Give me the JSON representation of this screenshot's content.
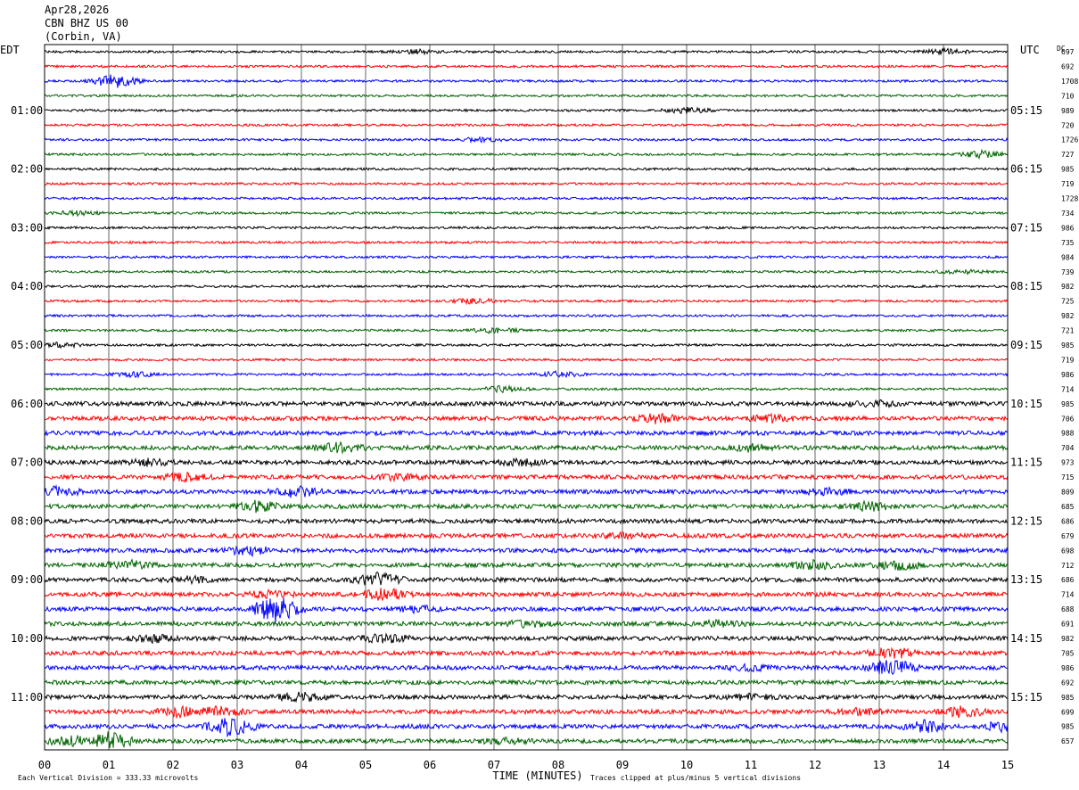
{
  "header": {
    "date": "Apr28,2026",
    "station": "CBN BHZ US 00",
    "location": "(Corbin, VA)"
  },
  "chart_data": {
    "type": "line",
    "title": "",
    "left_axis_label": "EDT",
    "right_axis_label": "UTC",
    "right_column_label": "DC",
    "xlabel": "TIME (MINUTES)",
    "x_ticks": [
      "00",
      "01",
      "02",
      "03",
      "04",
      "05",
      "06",
      "07",
      "08",
      "09",
      "10",
      "11",
      "12",
      "13",
      "14",
      "15"
    ],
    "xlim": [
      0,
      15
    ],
    "left_hour_labels": [
      "01:00",
      "02:00",
      "03:00",
      "04:00",
      "05:00",
      "06:00",
      "07:00",
      "08:00",
      "09:00",
      "10:00",
      "11:00"
    ],
    "right_hour_labels": [
      "05:15",
      "06:15",
      "07:15",
      "08:15",
      "09:15",
      "10:15",
      "11:15",
      "12:15",
      "13:15",
      "14:15",
      "15:15"
    ],
    "trace_colors": [
      "#000000",
      "#ff0000",
      "#0000ff",
      "#006400"
    ],
    "grid": true,
    "dc_offsets": [
      "697",
      "692",
      "1708",
      "710",
      "989",
      "720",
      "1726",
      "727",
      "985",
      "719",
      "1728",
      "734",
      "986",
      "735",
      "984",
      "739",
      "982",
      "725",
      "982",
      "721",
      "985",
      "719",
      "986",
      "714",
      "985",
      "706",
      "988",
      "704",
      "973",
      "715",
      "809",
      "685",
      "686",
      "679",
      "698",
      "712",
      "686",
      "714",
      "688",
      "691",
      "982",
      "705",
      "986",
      "692",
      "985",
      "699",
      "985",
      "657"
    ],
    "activity": [
      {
        "trace": 0,
        "events": [
          [
            5.8,
            1.2
          ],
          [
            14.0,
            1.6
          ]
        ]
      },
      {
        "trace": 1,
        "events": []
      },
      {
        "trace": 2,
        "events": [
          [
            1.1,
            4.5
          ]
        ]
      },
      {
        "trace": 3,
        "events": []
      },
      {
        "trace": 4,
        "events": [
          [
            10.0,
            1.8
          ]
        ]
      },
      {
        "trace": 5,
        "events": []
      },
      {
        "trace": 6,
        "events": [
          [
            6.8,
            1.3
          ]
        ]
      },
      {
        "trace": 7,
        "events": [
          [
            14.6,
            2.2
          ]
        ]
      },
      {
        "trace": 8,
        "events": []
      },
      {
        "trace": 9,
        "events": []
      },
      {
        "trace": 10,
        "events": []
      },
      {
        "trace": 11,
        "events": [
          [
            0.5,
            1.3
          ]
        ]
      },
      {
        "trace": 12,
        "events": []
      },
      {
        "trace": 13,
        "events": []
      },
      {
        "trace": 14,
        "events": []
      },
      {
        "trace": 15,
        "events": [
          [
            14.3,
            1.2
          ]
        ]
      },
      {
        "trace": 16,
        "events": []
      },
      {
        "trace": 17,
        "events": [
          [
            6.7,
            1.6
          ]
        ]
      },
      {
        "trace": 18,
        "events": []
      },
      {
        "trace": 19,
        "events": [
          [
            7.0,
            1.8
          ]
        ]
      },
      {
        "trace": 20,
        "events": [
          [
            0.2,
            1.4
          ]
        ]
      },
      {
        "trace": 21,
        "events": []
      },
      {
        "trace": 22,
        "events": [
          [
            1.4,
            1.6
          ],
          [
            8.0,
            1.8
          ]
        ]
      },
      {
        "trace": 23,
        "events": [
          [
            7.2,
            2.2
          ]
        ]
      },
      {
        "trace": 24,
        "events": [
          [
            12.9,
            1.8
          ]
        ]
      },
      {
        "trace": 25,
        "events": [
          [
            9.5,
            2.8
          ],
          [
            11.3,
            2.2
          ]
        ]
      },
      {
        "trace": 26,
        "events": []
      },
      {
        "trace": 27,
        "events": [
          [
            4.6,
            3.2
          ],
          [
            11.0,
            2.2
          ]
        ]
      },
      {
        "trace": 28,
        "events": [
          [
            1.6,
            1.8
          ],
          [
            7.4,
            2.0
          ]
        ]
      },
      {
        "trace": 29,
        "events": [
          [
            2.2,
            2.0
          ],
          [
            5.5,
            1.6
          ]
        ]
      },
      {
        "trace": 30,
        "events": [
          [
            0.2,
            2.8
          ],
          [
            3.9,
            3.2
          ],
          [
            12.2,
            1.8
          ]
        ]
      },
      {
        "trace": 31,
        "events": [
          [
            3.3,
            3.4
          ],
          [
            12.8,
            2.8
          ]
        ]
      },
      {
        "trace": 32,
        "events": []
      },
      {
        "trace": 33,
        "events": [
          [
            9.0,
            1.4
          ]
        ]
      },
      {
        "trace": 34,
        "events": [
          [
            3.2,
            2.8
          ]
        ]
      },
      {
        "trace": 35,
        "events": [
          [
            1.3,
            2.6
          ],
          [
            12.0,
            2.6
          ],
          [
            13.3,
            2.6
          ]
        ]
      },
      {
        "trace": 36,
        "events": [
          [
            5.2,
            4.2
          ],
          [
            2.3,
            1.8
          ]
        ]
      },
      {
        "trace": 37,
        "events": [
          [
            5.3,
            3.6
          ],
          [
            3.5,
            2.0
          ]
        ]
      },
      {
        "trace": 38,
        "events": [
          [
            3.6,
            9.0
          ],
          [
            5.8,
            1.8
          ]
        ]
      },
      {
        "trace": 39,
        "events": [
          [
            7.5,
            1.8
          ],
          [
            10.5,
            1.6
          ]
        ]
      },
      {
        "trace": 40,
        "events": [
          [
            1.7,
            2.0
          ],
          [
            5.3,
            2.8
          ]
        ]
      },
      {
        "trace": 41,
        "events": [
          [
            13.2,
            3.4
          ]
        ]
      },
      {
        "trace": 42,
        "events": [
          [
            13.2,
            5.0
          ],
          [
            11.0,
            1.6
          ]
        ]
      },
      {
        "trace": 43,
        "events": []
      },
      {
        "trace": 44,
        "events": [
          [
            4.0,
            2.6
          ],
          [
            11.0,
            1.6
          ]
        ]
      },
      {
        "trace": 45,
        "events": [
          [
            2.1,
            3.0
          ],
          [
            2.7,
            2.8
          ],
          [
            12.7,
            2.2
          ],
          [
            14.3,
            3.2
          ]
        ]
      },
      {
        "trace": 46,
        "events": [
          [
            2.9,
            6.0
          ],
          [
            13.7,
            3.8
          ],
          [
            14.9,
            2.6
          ]
        ]
      },
      {
        "trace": 47,
        "events": [
          [
            1.0,
            5.5
          ],
          [
            0.4,
            3.0
          ],
          [
            7.2,
            1.8
          ]
        ]
      }
    ]
  },
  "footer": {
    "scale_note": "Each Vertical Division =  333.33 microvolts",
    "clip_note": "Traces clipped at plus/minus 5 vertical divisions"
  }
}
